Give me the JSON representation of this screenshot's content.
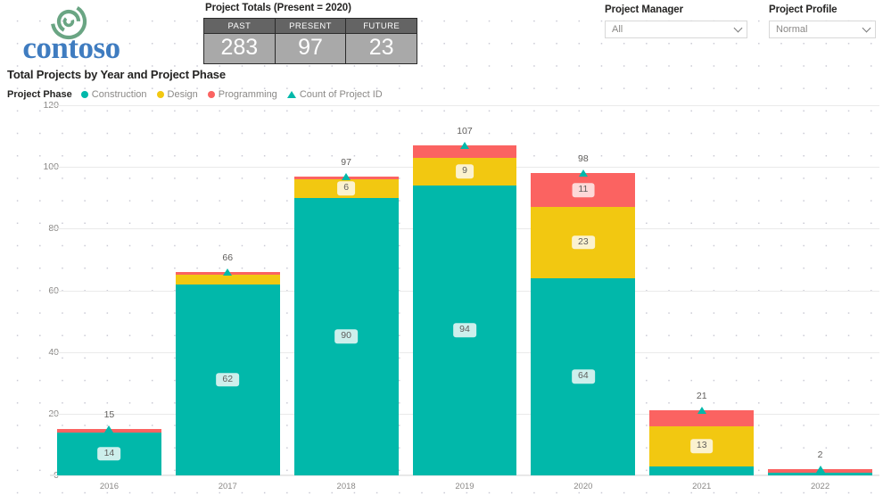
{
  "brand": {
    "logo_word": "contoso",
    "logo_mark_icon": "contoso-swirl-icon",
    "logo_mark_color": "#6aa583",
    "word_color": "#3f7cc0"
  },
  "kpi": {
    "title": "Project Totals (Present = 2020)",
    "columns": [
      "PAST",
      "PRESENT",
      "FUTURE"
    ],
    "values": [
      "283",
      "97",
      "23"
    ],
    "header_color": "#646464",
    "value_bg_color": "#a9a9a9"
  },
  "slicers": [
    {
      "label": "Project Manager",
      "value": "All",
      "caret_icon": "chevron-down-icon"
    },
    {
      "label": "Project Profile",
      "value": "Normal",
      "caret_icon": "chevron-down-icon"
    }
  ],
  "chart_data": {
    "type": "bar",
    "title": "Total Projects by Year and Project Phase",
    "subtype": "stacked-column-with-total-marker",
    "xlabel": "",
    "ylabel": "",
    "ylim": [
      0,
      120
    ],
    "yticks": [
      0,
      20,
      40,
      60,
      80,
      100,
      120
    ],
    "grid": true,
    "legend_position": "top-left",
    "legend_title": "Project Phase",
    "categories": [
      "2016",
      "2017",
      "2018",
      "2019",
      "2020",
      "2021",
      "2022"
    ],
    "series": [
      {
        "name": "Construction",
        "color": "#01b8aa",
        "values": [
          14,
          62,
          90,
          94,
          64,
          3,
          1
        ]
      },
      {
        "name": "Design",
        "color": "#f2c811",
        "values": [
          0,
          3,
          6,
          9,
          23,
          13,
          0
        ]
      },
      {
        "name": "Programming",
        "color": "#fb6361",
        "values": [
          1,
          1,
          1,
          4,
          11,
          5,
          1
        ]
      }
    ],
    "total_series": {
      "name": "Count of Project ID",
      "color": "#01b8aa",
      "marker": "triangle",
      "values": [
        15,
        66,
        97,
        107,
        98,
        21,
        2
      ]
    },
    "segment_labels": [
      {
        "category": "2016",
        "series": "Construction",
        "text": "14"
      },
      {
        "category": "2017",
        "series": "Construction",
        "text": "62"
      },
      {
        "category": "2018",
        "series": "Construction",
        "text": "90"
      },
      {
        "category": "2018",
        "series": "Design",
        "text": "6"
      },
      {
        "category": "2019",
        "series": "Construction",
        "text": "94"
      },
      {
        "category": "2019",
        "series": "Design",
        "text": "9"
      },
      {
        "category": "2020",
        "series": "Construction",
        "text": "64"
      },
      {
        "category": "2020",
        "series": "Design",
        "text": "23"
      },
      {
        "category": "2020",
        "series": "Programming",
        "text": "11"
      },
      {
        "category": "2021",
        "series": "Design",
        "text": "13"
      }
    ],
    "total_labels": [
      "15",
      "66",
      "97",
      "107",
      "98",
      "21",
      "2"
    ]
  }
}
